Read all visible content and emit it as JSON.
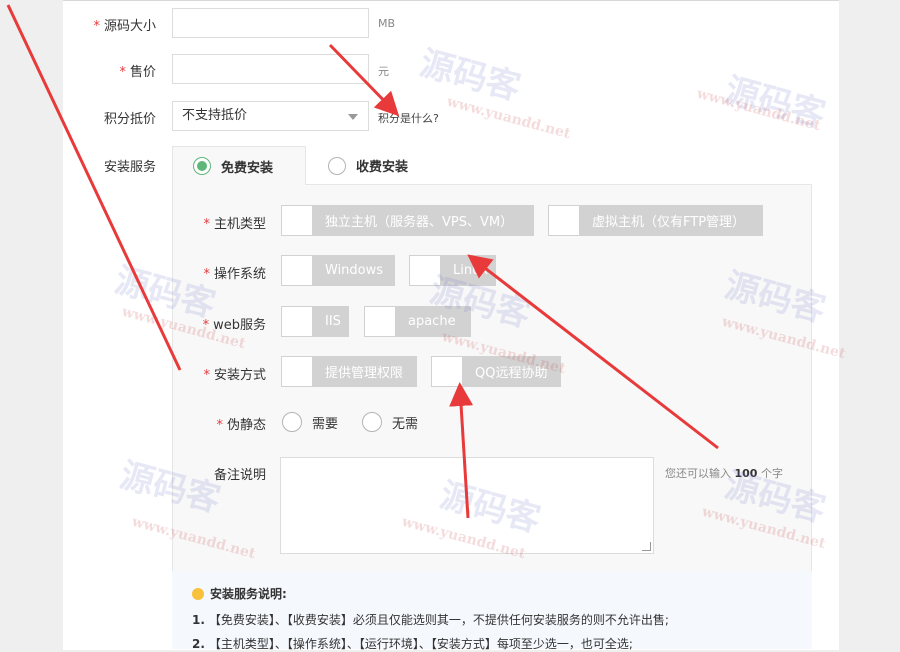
{
  "form": {
    "source_size": {
      "label": "源码大小",
      "value": "",
      "unit": "MB"
    },
    "price": {
      "label": "售价",
      "value": "",
      "unit": "元"
    },
    "points": {
      "label": "积分抵价",
      "selected": "不支持抵价",
      "help": "积分是什么?"
    },
    "install_service": {
      "label": "安装服务",
      "tabs": [
        {
          "label": "免费安装",
          "selected": true
        },
        {
          "label": "收费安装",
          "selected": false
        }
      ]
    }
  },
  "panel": {
    "host_type": {
      "label": "主机类型",
      "options": [
        "独立主机（服务器、VPS、VM）",
        "虚拟主机（仅有FTP管理）"
      ]
    },
    "os": {
      "label": "操作系统",
      "options": [
        "Windows",
        "Linux"
      ]
    },
    "web_service": {
      "label": "web服务",
      "options": [
        "IIS",
        "apache"
      ]
    },
    "install_method": {
      "label": "安装方式",
      "options": [
        "提供管理权限",
        "QQ远程协助"
      ]
    },
    "pseudo_static": {
      "label": "伪静态",
      "options": [
        "需要",
        "无需"
      ]
    },
    "remarks": {
      "label": "备注说明",
      "value": "",
      "hint_prefix": "您还可以输入",
      "hint_count": "100",
      "hint_suffix": "个字"
    }
  },
  "notes": {
    "title": "安装服务说明:",
    "items": [
      {
        "num": "1.",
        "text": "【免费安装】、【收费安装】必须且仅能选则其一，不提供任何安装服务的则不允许出售;"
      },
      {
        "num": "2.",
        "text": "【主机类型】、【操作系统】、【运行环境】、【安装方式】每项至少选一，也可全选;"
      }
    ]
  },
  "watermark": {
    "text": "源码客",
    "url": "www.yuandd.net",
    "sub": "YUANDD.Net"
  },
  "colors": {
    "required": "#e4393c",
    "radio_on": "#5fb878",
    "checkbox_bg": "#d2d2d2",
    "arrow": "#e83a3a"
  }
}
